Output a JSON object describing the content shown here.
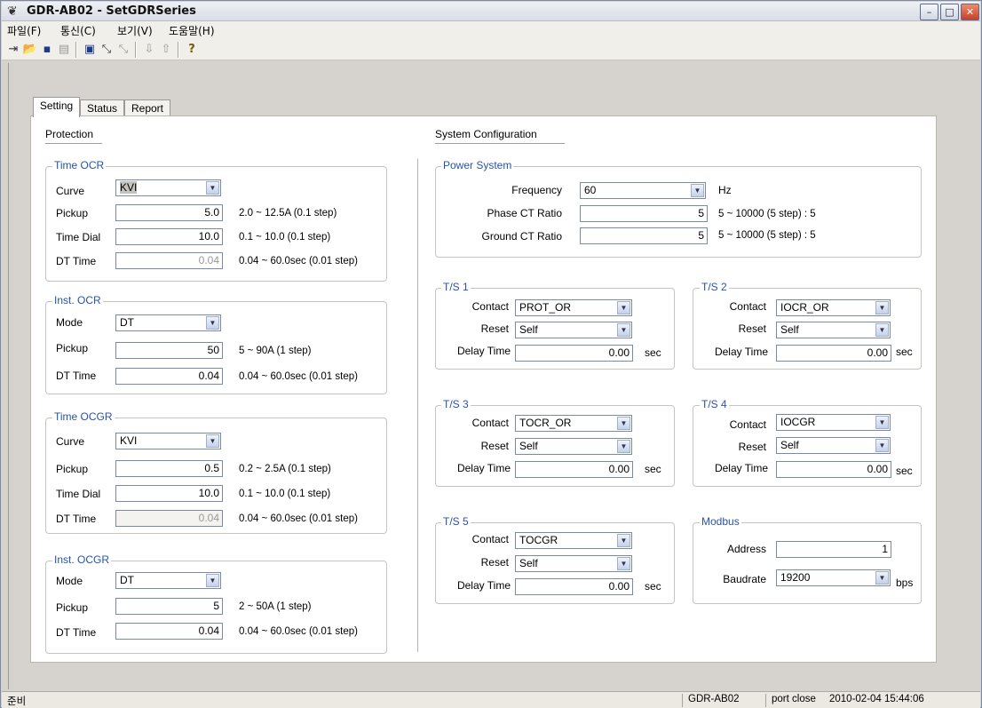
{
  "window": {
    "title": "GDR-AB02 - SetGDRSeries",
    "min": "–",
    "max": "□",
    "close": "✕"
  },
  "menu": [
    "파일(F)",
    "통신(C)",
    "보기(V)",
    "도움말(H)"
  ],
  "tabs": [
    "Setting",
    "Status",
    "Report"
  ],
  "protection": {
    "title": "Protection",
    "time_ocr": {
      "title": "Time OCR",
      "curve_label": "Curve",
      "curve": "KVI",
      "pickup_label": "Pickup",
      "pickup": "5.0",
      "pickup_range": "2.0 ~ 12.5A (0.1 step)",
      "dial_label": "Time Dial",
      "dial": "10.0",
      "dial_range": "0.1 ~ 10.0 (0.1 step)",
      "dt_label": "DT Time",
      "dt": "0.04",
      "dt_range": "0.04 ~ 60.0sec (0.01 step)"
    },
    "inst_ocr": {
      "title": "Inst. OCR",
      "mode_label": "Mode",
      "mode": "DT",
      "pickup_label": "Pickup",
      "pickup": "50",
      "pickup_range": "5 ~ 90A (1 step)",
      "dt_label": "DT Time",
      "dt": "0.04",
      "dt_range": "0.04 ~ 60.0sec (0.01 step)"
    },
    "time_ocgr": {
      "title": "Time OCGR",
      "curve_label": "Curve",
      "curve": "KVI",
      "pickup_label": "Pickup",
      "pickup": "0.5",
      "pickup_range": "0.2 ~ 2.5A (0.1 step)",
      "dial_label": "Time Dial",
      "dial": "10.0",
      "dial_range": "0.1 ~ 10.0 (0.1 step)",
      "dt_label": "DT Time",
      "dt": "0.04",
      "dt_range": "0.04 ~ 60.0sec (0.01 step)"
    },
    "inst_ocgr": {
      "title": "Inst. OCGR",
      "mode_label": "Mode",
      "mode": "DT",
      "pickup_label": "Pickup",
      "pickup": "5",
      "pickup_range": "2 ~ 50A (1 step)",
      "dt_label": "DT Time",
      "dt": "0.04",
      "dt_range": "0.04 ~ 60.0sec (0.01 step)"
    }
  },
  "system": {
    "title": "System Configuration",
    "power": {
      "title": "Power System",
      "freq_label": "Frequency",
      "freq": "60",
      "freq_unit": "Hz",
      "pct_label": "Phase CT Ratio",
      "pct": "5",
      "pct_range": "5 ~ 10000 (5 step) : 5",
      "gct_label": "Ground CT Ratio",
      "gct": "5",
      "gct_range": "5 ~ 10000 (5 step) : 5"
    },
    "ts1": {
      "title": "T/S 1",
      "contact_label": "Contact",
      "contact": "PROT_OR",
      "reset_label": "Reset",
      "reset": "Self",
      "delay_label": "Delay Time",
      "delay": "0.00",
      "unit": "sec"
    },
    "ts2": {
      "title": "T/S 2",
      "contact_label": "Contact",
      "contact": "IOCR_OR",
      "reset_label": "Reset",
      "reset": "Self",
      "delay_label": "Delay Time",
      "delay": "0.00",
      "unit": "sec"
    },
    "ts3": {
      "title": "T/S 3",
      "contact_label": "Contact",
      "contact": "TOCR_OR",
      "reset_label": "Reset",
      "reset": "Self",
      "delay_label": "Delay Time",
      "delay": "0.00",
      "unit": "sec"
    },
    "ts4": {
      "title": "T/S 4",
      "contact_label": "Contact",
      "contact": "IOCGR",
      "reset_label": "Reset",
      "reset": "Self",
      "delay_label": "Delay Time",
      "delay": "0.00",
      "unit": "sec"
    },
    "ts5": {
      "title": "T/S 5",
      "contact_label": "Contact",
      "contact": "TOCGR",
      "reset_label": "Reset",
      "reset": "Self",
      "delay_label": "Delay Time",
      "delay": "0.00",
      "unit": "sec"
    },
    "modbus": {
      "title": "Modbus",
      "addr_label": "Address",
      "addr": "1",
      "baud_label": "Baudrate",
      "baud": "19200",
      "baud_unit": "bps"
    }
  },
  "status": {
    "ready": "준비",
    "device": "GDR-AB02",
    "port": "port close",
    "datetime": "2010-02-04 15:44:06"
  }
}
